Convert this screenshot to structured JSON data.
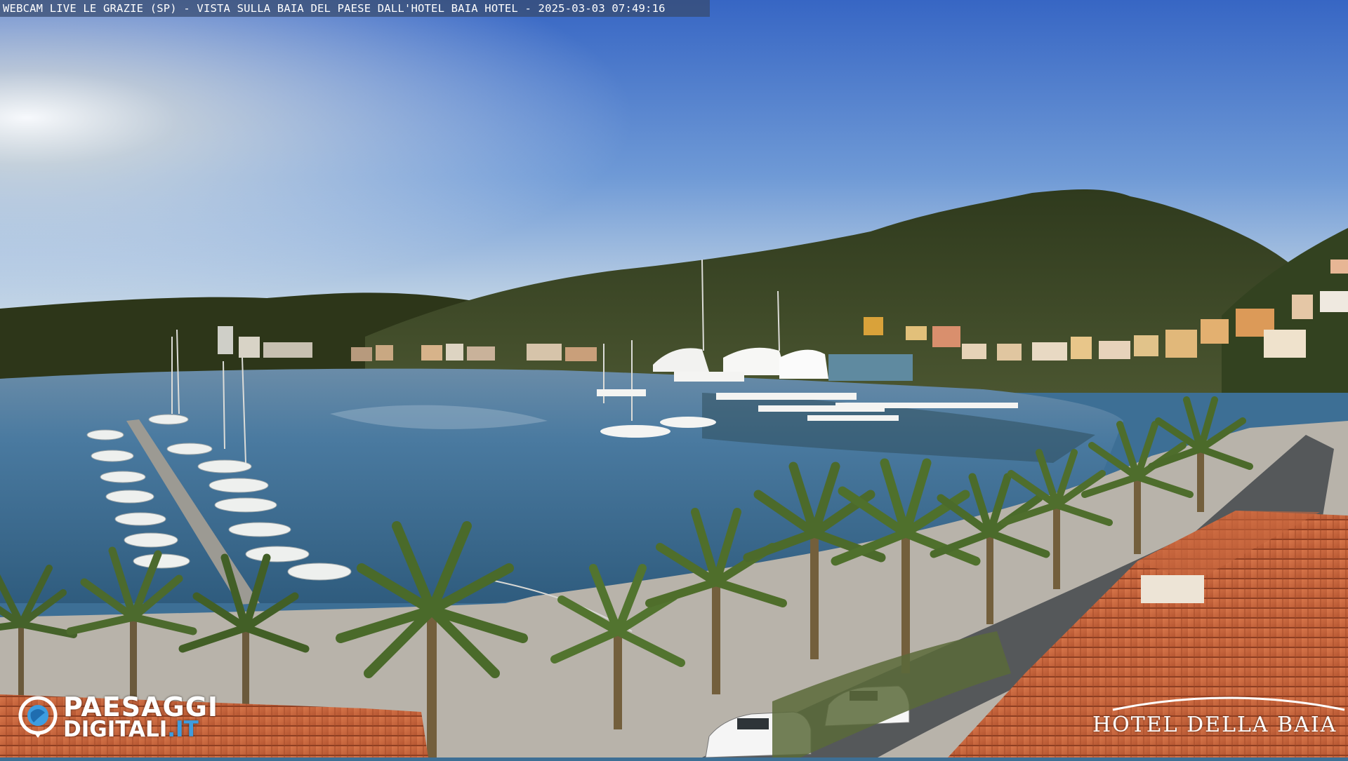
{
  "overlay": {
    "caption": "WEBCAM LIVE LE GRAZIE (SP) - VISTA SULLA BAIA DEL PAESE DALL'HOTEL BAIA HOTEL - 2025-03-03 07:49:16"
  },
  "logos": {
    "left": {
      "line1": "PAESAGGI",
      "line2_main": "DIGITALI",
      "line2_tld": ".IT",
      "icon": "globe-camera-icon"
    },
    "right": {
      "name": "HOTEL DELLA BAIA",
      "icon": "arc-swoosh-icon"
    }
  },
  "colors": {
    "sky_top": "#3a6ec9",
    "sky_horizon": "#dfe8ee",
    "sun_glow": "#fffbe8",
    "water": "#3e6f93",
    "hills": "#3d4a25",
    "promenade": "#b9b4ad",
    "roof_tiles": "#c9643b",
    "palm_green": "#4f6d2c",
    "text_tld_blue": "#3d9de0"
  }
}
